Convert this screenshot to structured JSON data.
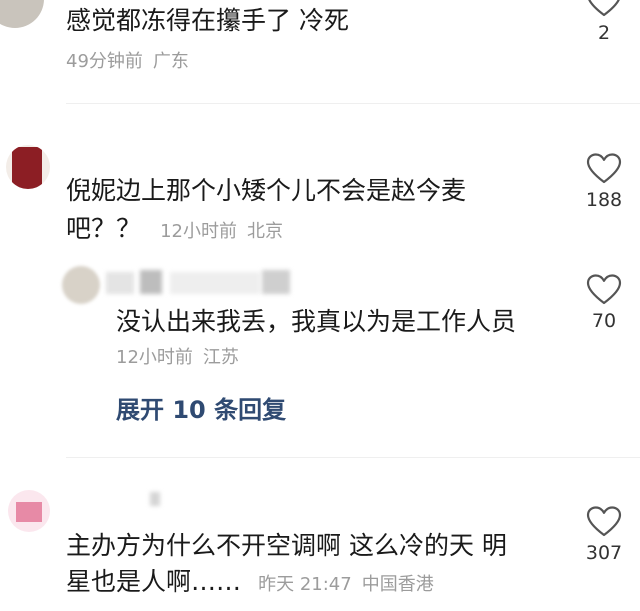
{
  "comments": [
    {
      "text_lines": [
        "感觉都冻得在攥手了 冷死"
      ],
      "time": "49分钟前",
      "location": "广东",
      "likes": "2",
      "avatar_color": "#b9b3aa"
    },
    {
      "text_lines": [
        "倪妮边上那个小矮个儿不会是赵今麦",
        "吧？？"
      ],
      "time": "12小时前",
      "location": "北京",
      "likes": "188",
      "avatar_color": "#8c1e24",
      "reply": {
        "text": "没认出来我丢，我真以为是工作人员",
        "time": "12小时前",
        "location": "江苏",
        "likes": "70"
      },
      "expand_label": "展开 10 条回复"
    },
    {
      "text_lines": [
        "主办方为什么不开空调啊 这么冷的天 明",
        "星也是人啊……"
      ],
      "time": "昨天 21:47",
      "location": "中国香港",
      "likes": "307",
      "avatar_color": "#e78aa6"
    }
  ],
  "icons": {
    "like": "heart-outline-icon"
  },
  "colors": {
    "expand_link": "#2f4a72",
    "meta": "#9c9c9c"
  }
}
